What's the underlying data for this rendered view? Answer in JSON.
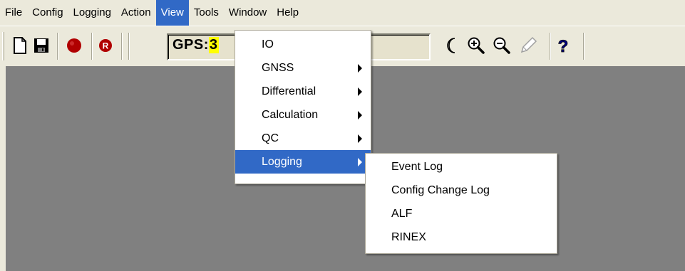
{
  "menubar": {
    "items": [
      "File",
      "Config",
      "Logging",
      "Action",
      "View",
      "Tools",
      "Window",
      "Help"
    ]
  },
  "toolbar": {
    "gps_label": "GPS:",
    "gps_value": "3",
    "icons": [
      "new-document-icon",
      "save-icon",
      "record-icon",
      "record-r-icon",
      "moon-icon",
      "zoom-in-icon",
      "zoom-out-icon",
      "pencil-icon",
      "help-icon"
    ]
  },
  "view_menu": {
    "items": [
      {
        "label": "IO",
        "submenu": false
      },
      {
        "label": "GNSS",
        "submenu": true
      },
      {
        "label": "Differential",
        "submenu": true
      },
      {
        "label": "Calculation",
        "submenu": true
      },
      {
        "label": "QC",
        "submenu": true
      },
      {
        "label": "Logging",
        "submenu": true,
        "highlighted": true
      }
    ]
  },
  "logging_submenu": {
    "items": [
      "Event Log",
      "Config Change Log",
      "ALF",
      "RINEX"
    ]
  },
  "colors": {
    "menu_highlight": "#3169c6",
    "client_area": "#808080",
    "chrome": "#ebe9db",
    "gps_value_bg": "#ffff00",
    "record_red": "#b00000"
  }
}
